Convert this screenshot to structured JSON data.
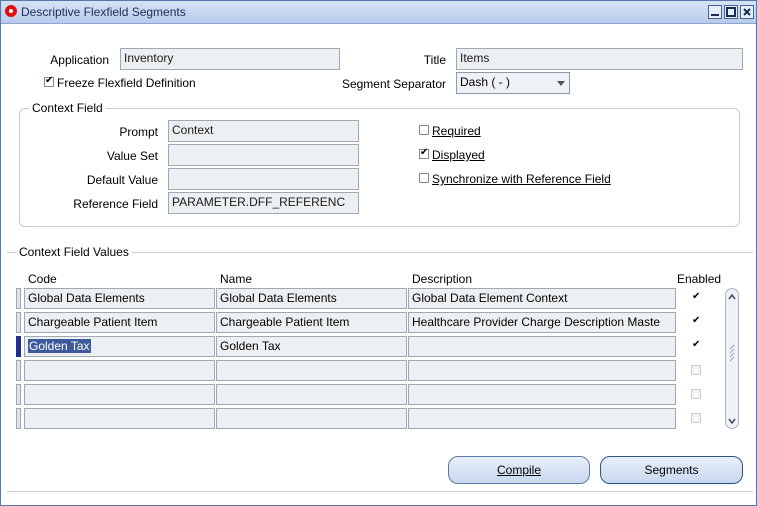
{
  "window": {
    "title": "Descriptive Flexfield Segments"
  },
  "header": {
    "application_label": "Application",
    "application_value": "Inventory",
    "title_label": "Title",
    "title_value": "Items",
    "freeze_label": "Freeze Flexfield Definition",
    "freeze_checked": true,
    "separator_label": "Segment Separator",
    "separator_value": "Dash ( - )"
  },
  "context_field": {
    "group_title": "Context Field",
    "prompt_label": "Prompt",
    "prompt_value": "Context",
    "value_set_label": "Value Set",
    "value_set_value": "",
    "default_value_label": "Default Value",
    "default_value_value": "",
    "reference_field_label": "Reference Field",
    "reference_field_value": "PARAMETER.DFF_REFERENC",
    "required_label": "Required",
    "required_checked": false,
    "displayed_label": "Displayed",
    "displayed_checked": true,
    "sync_label": "Synchronize with Reference Field",
    "sync_checked": false
  },
  "context_values": {
    "group_title": "Context Field Values",
    "columns": {
      "code": "Code",
      "name": "Name",
      "description": "Description",
      "enabled": "Enabled"
    },
    "rows": [
      {
        "code": "Global Data Elements",
        "name": "Global Data Elements",
        "description": "Global Data Element Context",
        "enabled": true
      },
      {
        "code": "Chargeable Patient Item",
        "name": "Chargeable Patient Item",
        "description": "Healthcare Provider Charge Description Maste",
        "enabled": true
      },
      {
        "code": "Golden Tax",
        "name": "Golden Tax",
        "description": "",
        "enabled": true
      },
      {
        "code": "",
        "name": "",
        "description": "",
        "enabled": false
      },
      {
        "code": "",
        "name": "",
        "description": "",
        "enabled": false
      },
      {
        "code": "",
        "name": "",
        "description": "",
        "enabled": false
      }
    ]
  },
  "buttons": {
    "compile": "Compile",
    "segments": "Segments"
  },
  "icons": {
    "app_icon": "oracle-icon",
    "minimize": "minimize-icon",
    "maximize": "maximize-icon",
    "close": "close-icon"
  }
}
